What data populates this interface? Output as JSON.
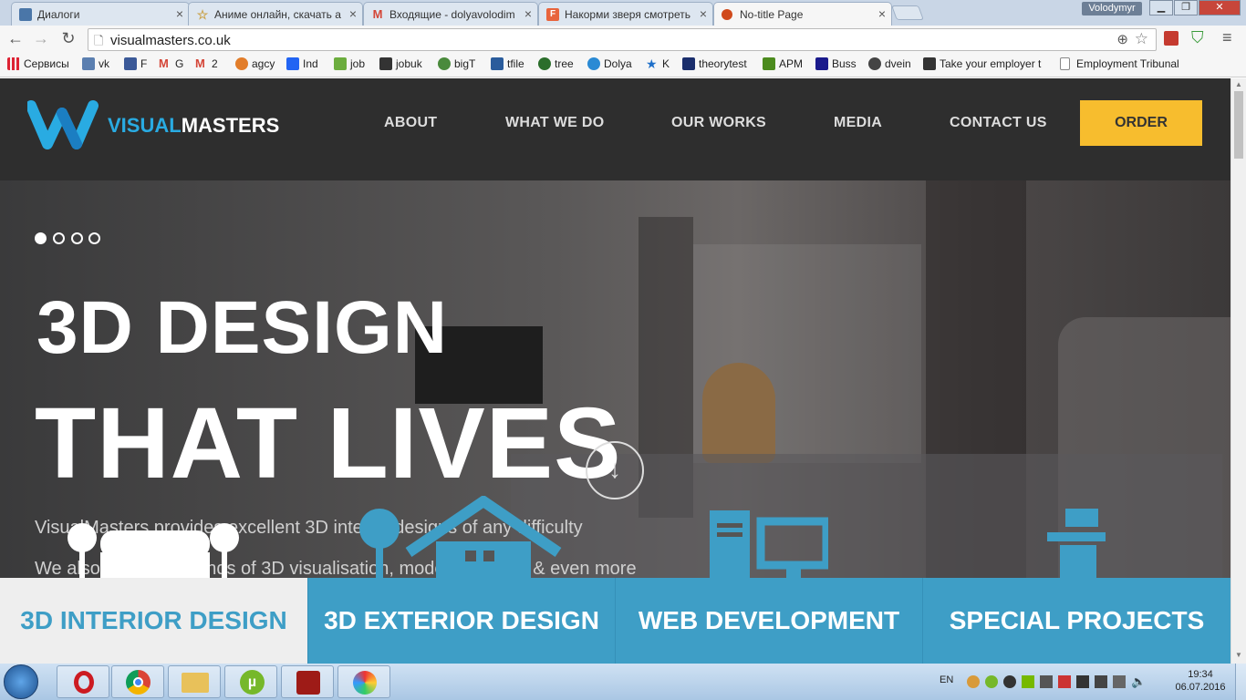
{
  "browser": {
    "tabs": [
      {
        "title": "Диалоги",
        "icon": "vk-icon",
        "color": "#4a76a8"
      },
      {
        "title": "Аниме онлайн, скачать а",
        "icon": "star-icon",
        "color": "#caa34b"
      },
      {
        "title": "Входящие - dolyavolodim",
        "icon": "gmail-icon",
        "color": "#d44638"
      },
      {
        "title": "Накорми зверя смотреть",
        "icon": "f-icon",
        "color": "#e8643c"
      },
      {
        "title": "No-title Page",
        "icon": "page-icon",
        "color": "#d04a1c"
      }
    ],
    "user": "Volodymyr",
    "url": "visualmasters.co.uk",
    "bookmarks": [
      {
        "label": "Сервисы",
        "icon": "apps-icon",
        "color": "#d23"
      },
      {
        "label": "vk",
        "icon": "vk-bm-icon",
        "color": "#5b7fb0"
      },
      {
        "label": "F",
        "icon": "facebook-icon",
        "color": "#3b5998"
      },
      {
        "label": "G",
        "icon": "gmail-bm-icon",
        "color": "#d44638"
      },
      {
        "label": "2",
        "icon": "gmail2-icon",
        "color": "#d44638"
      },
      {
        "label": "agcy",
        "icon": "agcy-icon",
        "color": "#e27d2a"
      },
      {
        "label": "Ind",
        "icon": "ind-icon",
        "color": "#2164f3"
      },
      {
        "label": "job",
        "icon": "job-icon",
        "color": "#6cad3e"
      },
      {
        "label": "jobuk",
        "icon": "jobuk-icon",
        "color": "#333"
      },
      {
        "label": "bigT",
        "icon": "bigt-icon",
        "color": "#4a8a3c"
      },
      {
        "label": "tfile",
        "icon": "tfile-icon",
        "color": "#2a5c9c"
      },
      {
        "label": "tree",
        "icon": "tree-icon",
        "color": "#2b6e2b"
      },
      {
        "label": "Dolya",
        "icon": "dolya-icon",
        "color": "#2a8ad4"
      },
      {
        "label": "K",
        "icon": "k-star-icon",
        "color": "#1e6fc9"
      },
      {
        "label": "theorytest",
        "icon": "theorytest-icon",
        "color": "#1a2e6c"
      },
      {
        "label": "APM",
        "icon": "apm-icon",
        "color": "#4c8b1e"
      },
      {
        "label": "Buss",
        "icon": "buss-icon",
        "color": "#1a1a8c"
      },
      {
        "label": "dvein",
        "icon": "dvein-icon",
        "color": "#444"
      },
      {
        "label": "Take your employer t",
        "icon": "employer-icon",
        "color": "#333"
      },
      {
        "label": "Employment Tribunal",
        "icon": "doc-icon",
        "color": "#888"
      }
    ]
  },
  "site": {
    "logo_visual": "VISUAL",
    "logo_masters": "MASTERS",
    "menu": [
      "ABOUT",
      "WHAT WE DO",
      "OUR WORKS",
      "MEDIA",
      "CONTACT US"
    ],
    "order": "ORDER",
    "slides": 4,
    "active_slide": 1,
    "headline1": "3D DESIGN",
    "headline2": "THAT LIVES",
    "sub1": "VisualMasters provides excellent 3D interior designs of any difficulty",
    "sub2": "We also offer other kinds of 3D visualisation, models creation & even more",
    "services": [
      "3D INTERIOR DESIGN",
      "3D EXTERIOR DESIGN",
      "WEB DEVELOPMENT",
      "SPECIAL PROJECTS"
    ],
    "colors": {
      "accent": "#3e9ec6",
      "order": "#f7bd2e",
      "logo_blue": "#29abe2"
    }
  },
  "taskbar": {
    "apps": [
      "start-icon",
      "opera-icon",
      "chrome-icon",
      "explorer-icon",
      "utorrent-icon",
      "dota-icon",
      "paint-icon"
    ],
    "lang": "EN",
    "time": "19:34",
    "date": "06.07.2016"
  }
}
